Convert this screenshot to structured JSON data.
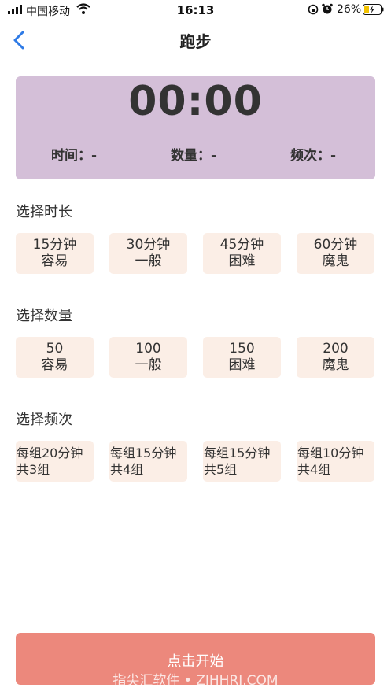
{
  "status_bar": {
    "carrier": "中国移动",
    "time": "16:13",
    "battery": "26%"
  },
  "nav": {
    "title": "跑步"
  },
  "timer": {
    "display": "00:00",
    "time_label": "时间：-",
    "count_label": "数量：-",
    "freq_label": "频次：-"
  },
  "duration": {
    "title": "选择时长",
    "options": [
      {
        "line1": "15分钟",
        "line2": "容易"
      },
      {
        "line1": "30分钟",
        "line2": "一般"
      },
      {
        "line1": "45分钟",
        "line2": "困难"
      },
      {
        "line1": "60分钟",
        "line2": "魔鬼"
      }
    ]
  },
  "quantity": {
    "title": "选择数量",
    "options": [
      {
        "line1": "50",
        "line2": "容易"
      },
      {
        "line1": "100",
        "line2": "一般"
      },
      {
        "line1": "150",
        "line2": "困难"
      },
      {
        "line1": "200",
        "line2": "魔鬼"
      }
    ]
  },
  "frequency": {
    "title": "选择频次",
    "options": [
      {
        "line1": "每组20分钟",
        "line2": "共3组"
      },
      {
        "line1": "每组15分钟",
        "line2": "共4组"
      },
      {
        "line1": "每组15分钟",
        "line2": "共5组"
      },
      {
        "line1": "每组10分钟",
        "line2": "共4组"
      }
    ]
  },
  "start_button": {
    "label": "点击开始"
  },
  "watermark": "指尖汇软件 • ZJHHRJ.COM",
  "colors": {
    "accent_blue": "#2f7be6",
    "card_bg": "#d4bfd8",
    "option_bg": "#fbeee6",
    "button_bg": "#ec887c"
  }
}
